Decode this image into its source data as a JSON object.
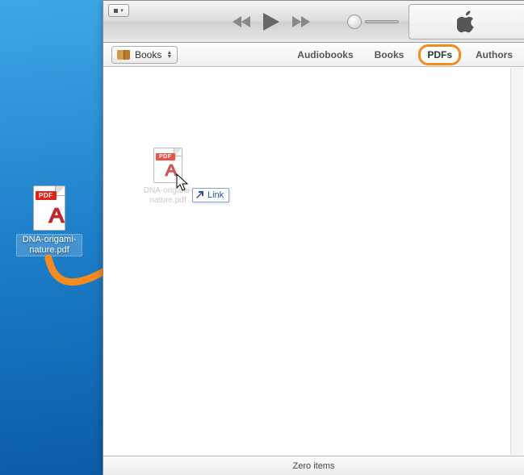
{
  "desktop": {
    "file": {
      "name": "DNA-origami-nature.pdf",
      "badge": "PDF"
    }
  },
  "drag": {
    "tooltip": "Link"
  },
  "itunes": {
    "library_selector": {
      "label": "Books"
    },
    "tabs": [
      {
        "id": "audiobooks",
        "label": "Audiobooks",
        "active": false
      },
      {
        "id": "books",
        "label": "Books",
        "active": false
      },
      {
        "id": "pdfs",
        "label": "PDFs",
        "active": true
      },
      {
        "id": "authors",
        "label": "Authors",
        "active": false
      }
    ],
    "drop_ghost": {
      "badge": "PDF",
      "filename": "DNA-origami-nature.pdf"
    },
    "status": "Zero items"
  }
}
